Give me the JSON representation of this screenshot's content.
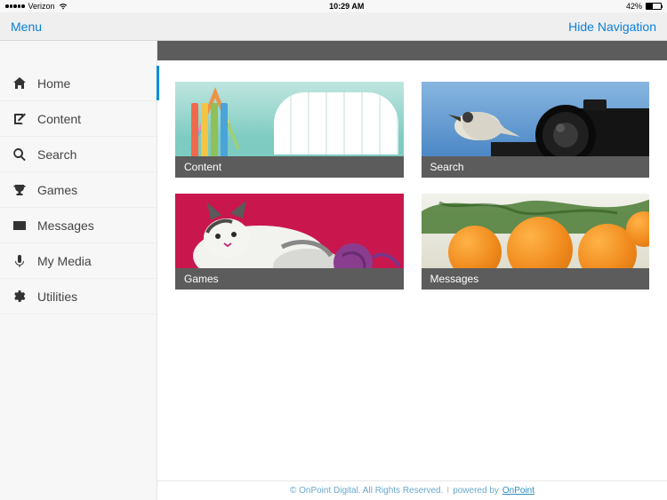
{
  "status": {
    "carrier": "Verizon",
    "time": "10:29 AM",
    "battery_pct": "42%"
  },
  "nav": {
    "menu": "Menu",
    "hide": "Hide Navigation"
  },
  "sidebar": {
    "items": [
      {
        "label": "Home",
        "icon": "home"
      },
      {
        "label": "Content",
        "icon": "edit"
      },
      {
        "label": "Search",
        "icon": "search"
      },
      {
        "label": "Games",
        "icon": "trophy"
      },
      {
        "label": "Messages",
        "icon": "envelope"
      },
      {
        "label": "My Media",
        "icon": "mic"
      },
      {
        "label": "Utilities",
        "icon": "gear"
      }
    ]
  },
  "tiles": [
    {
      "label": "Content"
    },
    {
      "label": "Search"
    },
    {
      "label": "Games"
    },
    {
      "label": "Messages"
    }
  ],
  "footer": {
    "copyright": "© OnPoint Digital. All Rights Reserved.",
    "sep": "I",
    "powered": "powered by",
    "brand": "OnPoint"
  }
}
